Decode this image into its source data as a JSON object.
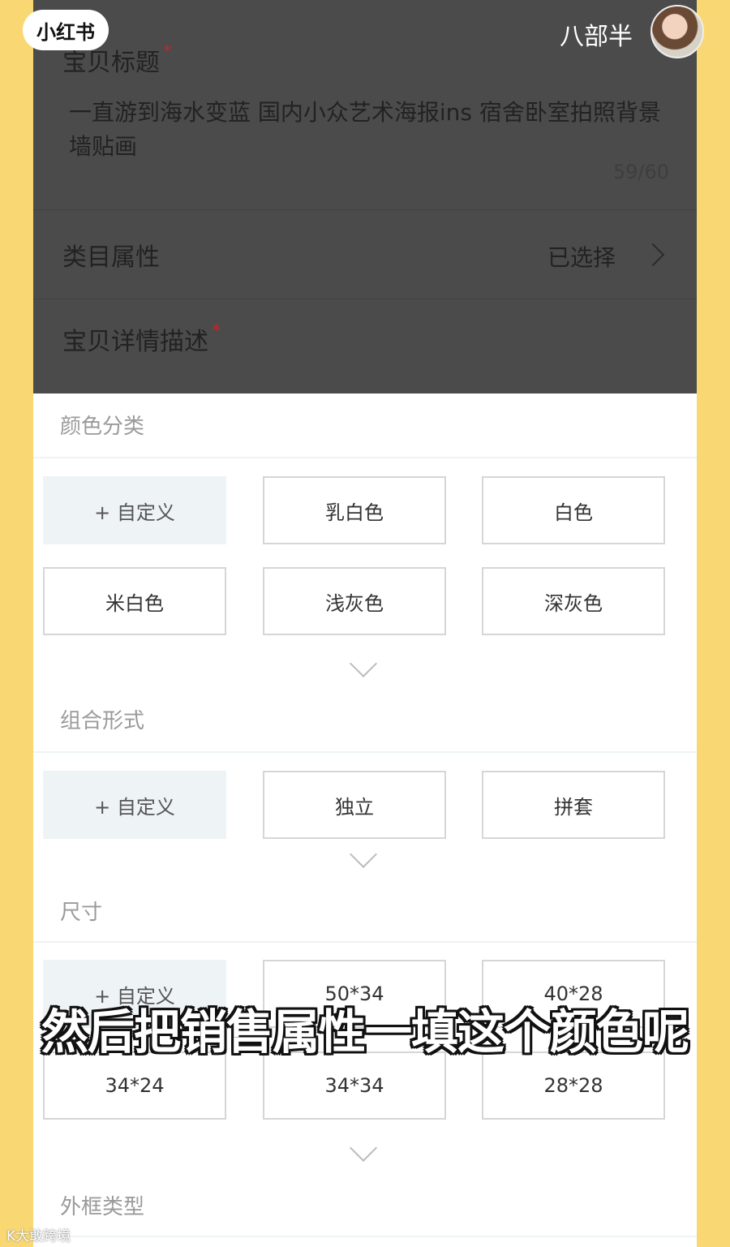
{
  "app": {
    "logo_text": "小红书",
    "username": "八部半",
    "watermark": "K大敢跨境"
  },
  "top_form": {
    "title_label": "宝贝标题",
    "required_mark": "*",
    "title_value": "一直游到海水变蓝 国内小众艺术海报ins 宿舍卧室拍照背景墙贴画",
    "counter": "59/60",
    "category_label": "类目属性",
    "category_value": "已选择",
    "desc_label": "宝贝详情描述"
  },
  "sections": {
    "color": {
      "title": "颜色分类",
      "options": [
        "+ 自定义",
        "乳白色",
        "白色",
        "米白色",
        "浅灰色",
        "深灰色"
      ]
    },
    "combo": {
      "title": "组合形式",
      "options": [
        "+ 自定义",
        "独立",
        "拼套"
      ]
    },
    "size": {
      "title": "尺寸",
      "options": [
        "+ 自定义",
        "50*34",
        "40*28",
        "34*24",
        "34*34",
        "28*28"
      ]
    },
    "frame": {
      "title": "外框类型"
    }
  },
  "subtitle": "然后把销售属性一填这个颜色呢"
}
